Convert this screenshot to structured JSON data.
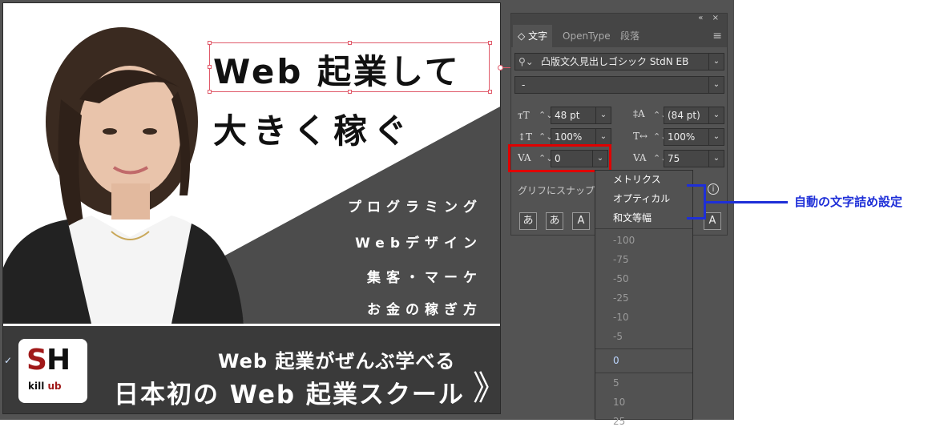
{
  "banner_ad": {
    "headline_line1": "Web 起業して",
    "headline_line2": "大きく稼ぐ",
    "topics": [
      "プログラミング",
      "Webデザイン",
      "集客・マーケ",
      "お金の稼ぎ方"
    ],
    "bottom_line1": "Web 起業がぜんぶ学べる",
    "bottom_line2": "日本初の Web 起業スクール",
    "arrow": "》",
    "logo_main_s": "S",
    "logo_main_h": "H",
    "logo_sub_k": "kill",
    "logo_sub_ub": " ub"
  },
  "panel": {
    "collapse_icon": "«",
    "close_icon": "×",
    "tabs": [
      "文字",
      "OpenType",
      "段落"
    ],
    "tab_prefix": "◇",
    "menu_icon": "≡",
    "font_family": "凸版文久見出しゴシック StdN EB",
    "font_style": "-",
    "font_size": "48 pt",
    "leading": "(84 pt)",
    "vertical_scale": "100%",
    "horizontal_scale": "100%",
    "kerning": "0",
    "tracking": "75",
    "snap_label": "グリフにスナップ",
    "info_icon": "i",
    "glyph_buttons": [
      "あ",
      "あ",
      "A",
      "A"
    ]
  },
  "kerning_dropdown": {
    "top_options": [
      "メトリクス",
      "オプティカル",
      "和文等幅"
    ],
    "values": [
      "-100",
      "-75",
      "-50",
      "-25",
      "-10",
      "-5",
      "0",
      "5",
      "10",
      "25"
    ],
    "selected": "0",
    "check_mark": "✓"
  },
  "annotation": {
    "label": "自動の文字詰め設定",
    "color": "#1e2fd8"
  },
  "colors": {
    "selection": "#e05a6a",
    "highlight": "#e00000",
    "panel_bg": "#535353",
    "logo_accent": "#a01818"
  }
}
